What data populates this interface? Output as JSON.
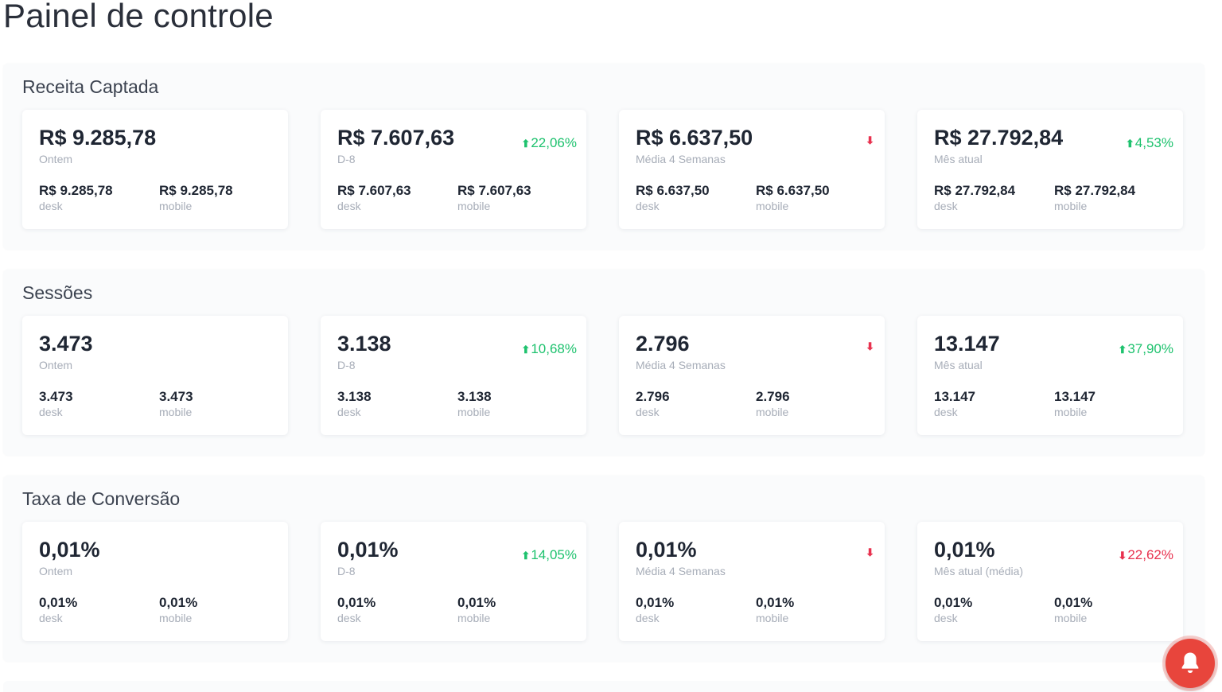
{
  "page": {
    "title": "Painel de controle"
  },
  "colors": {
    "up": "#1ec26e",
    "down": "#e8324f",
    "bell": "#e8453c"
  },
  "sections": [
    {
      "title": "Receita Captada",
      "cards": [
        {
          "value": "R$ 9.285,78",
          "label": "Ontem",
          "trend": {
            "dir": "",
            "text": ""
          },
          "desk": "R$ 9.285,78",
          "desk_label": "desk",
          "mobile": "R$ 9.285,78",
          "mobile_label": "mobile"
        },
        {
          "value": "R$ 7.607,63",
          "label": "D-8",
          "trend": {
            "dir": "up",
            "text": "22,06%"
          },
          "desk": "R$ 7.607,63",
          "desk_label": "desk",
          "mobile": "R$ 7.607,63",
          "mobile_label": "mobile"
        },
        {
          "value": "R$ 6.637,50",
          "label": "Média 4 Semanas",
          "trend": {
            "dir": "down",
            "text": ""
          },
          "desk": "R$ 6.637,50",
          "desk_label": "desk",
          "mobile": "R$ 6.637,50",
          "mobile_label": "mobile"
        },
        {
          "value": "R$ 27.792,84",
          "label": "Mês atual",
          "trend": {
            "dir": "up",
            "text": "4,53%"
          },
          "desk": "R$ 27.792,84",
          "desk_label": "desk",
          "mobile": "R$ 27.792,84",
          "mobile_label": "mobile"
        }
      ]
    },
    {
      "title": "Sessões",
      "cards": [
        {
          "value": "3.473",
          "label": "Ontem",
          "trend": {
            "dir": "",
            "text": ""
          },
          "desk": "3.473",
          "desk_label": "desk",
          "mobile": "3.473",
          "mobile_label": "mobile"
        },
        {
          "value": "3.138",
          "label": "D-8",
          "trend": {
            "dir": "up",
            "text": "10,68%"
          },
          "desk": "3.138",
          "desk_label": "desk",
          "mobile": "3.138",
          "mobile_label": "mobile"
        },
        {
          "value": "2.796",
          "label": "Média 4 Semanas",
          "trend": {
            "dir": "down",
            "text": ""
          },
          "desk": "2.796",
          "desk_label": "desk",
          "mobile": "2.796",
          "mobile_label": "mobile"
        },
        {
          "value": "13.147",
          "label": "Mês atual",
          "trend": {
            "dir": "up",
            "text": "37,90%"
          },
          "desk": "13.147",
          "desk_label": "desk",
          "mobile": "13.147",
          "mobile_label": "mobile"
        }
      ]
    },
    {
      "title": "Taxa de Conversão",
      "cards": [
        {
          "value": "0,01%",
          "label": "Ontem",
          "trend": {
            "dir": "",
            "text": ""
          },
          "desk": "0,01%",
          "desk_label": "desk",
          "mobile": "0,01%",
          "mobile_label": "mobile"
        },
        {
          "value": "0,01%",
          "label": "D-8",
          "trend": {
            "dir": "up",
            "text": "14,05%"
          },
          "desk": "0,01%",
          "desk_label": "desk",
          "mobile": "0,01%",
          "mobile_label": "mobile"
        },
        {
          "value": "0,01%",
          "label": "Média 4 Semanas",
          "trend": {
            "dir": "down",
            "text": ""
          },
          "desk": "0,01%",
          "desk_label": "desk",
          "mobile": "0,01%",
          "mobile_label": "mobile"
        },
        {
          "value": "0,01%",
          "label": "Mês atual (média)",
          "trend": {
            "dir": "down",
            "text": "22,62%"
          },
          "desk": "0,01%",
          "desk_label": "desk",
          "mobile": "0,01%",
          "mobile_label": "mobile"
        }
      ]
    }
  ],
  "notification_button": {
    "icon": "bell-icon"
  }
}
